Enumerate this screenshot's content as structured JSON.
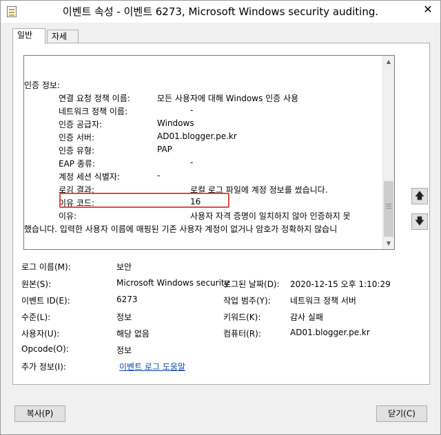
{
  "window": {
    "title": "이벤트 속성 - 이벤트 6273, Microsoft Windows security auditing.",
    "close_glyph": "✕"
  },
  "tabs": [
    {
      "label": "일반",
      "active": true
    },
    {
      "label": "자세히",
      "active": false
    }
  ],
  "description": {
    "section_header": "인증 정보:",
    "rows": [
      {
        "label": "연결 요청 정책 이름:",
        "value": "모든 사용자에 대해 Windows 인증 사용"
      },
      {
        "label": "네트워크 정책 이름:",
        "value": "-"
      },
      {
        "label": "인증 공급자:",
        "value": "Windows"
      },
      {
        "label": "인증 서버:",
        "value": "AD01.blogger.pe.kr"
      },
      {
        "label": "인증 유형:",
        "value": "PAP"
      },
      {
        "label": "EAP 종류:",
        "value": "-"
      },
      {
        "label": "계정 세션 식별자:",
        "value": "-"
      },
      {
        "label": "로깅 결과:",
        "value": "로컬 로그 파일에 계정 정보를 썼습니다."
      },
      {
        "label": "이유 코드:",
        "value": "16"
      },
      {
        "label": "이유:",
        "value": "사용자 자격 증명이 일치하지 않아 인증하지 못"
      }
    ],
    "wrap_line": "했습니다. 입력한 사용자 이름에 매핑된 기존 사용자 계정이 없거나 암호가 정확하지 않습니"
  },
  "side_buttons": {
    "up_glyph": "🡅",
    "down_glyph": "🡇"
  },
  "details": {
    "log_name": {
      "label": "로그 이름(M):",
      "value": "보안"
    },
    "source": {
      "label": "원본(S):",
      "value": "Microsoft Windows security"
    },
    "logged": {
      "label": "로그된 날짜(D):",
      "value": "2020-12-15 오후 1:10:29"
    },
    "event_id": {
      "label": "이벤트 ID(E):",
      "value": "6273"
    },
    "task_category": {
      "label": "작업 범주(Y):",
      "value": "네트워크 정책 서버"
    },
    "level": {
      "label": "수준(L):",
      "value": "정보"
    },
    "keywords": {
      "label": "키워드(K):",
      "value": "감사 실패"
    },
    "user": {
      "label": "사용자(U):",
      "value": "해당 없음"
    },
    "computer": {
      "label": "컴퓨터(R):",
      "value": "AD01.blogger.pe.kr"
    },
    "opcode": {
      "label": "Opcode(O):",
      "value": "정보"
    },
    "more_info": {
      "label": "추가 정보(I):",
      "link": "이벤트 로그 도움말"
    }
  },
  "buttons": {
    "copy": "복사(P)",
    "close": "닫기(C)"
  },
  "colors": {
    "highlight_border": "#e04a3c",
    "link": "#0645ad"
  }
}
